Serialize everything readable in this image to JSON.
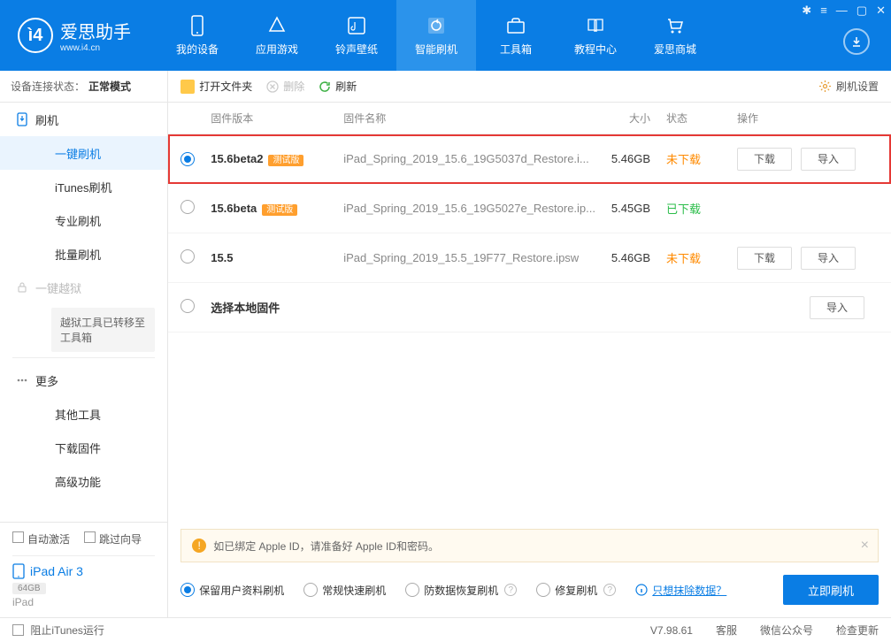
{
  "app": {
    "name": "爱思助手",
    "domain": "www.i4.cn"
  },
  "nav": {
    "items": [
      {
        "label": "我的设备"
      },
      {
        "label": "应用游戏"
      },
      {
        "label": "铃声壁纸"
      },
      {
        "label": "智能刷机"
      },
      {
        "label": "工具箱"
      },
      {
        "label": "教程中心"
      },
      {
        "label": "爱思商城"
      }
    ]
  },
  "status": {
    "prefix": "设备连接状态：",
    "value": "正常模式"
  },
  "sidebar": {
    "flash": "刷机",
    "items": [
      "一键刷机",
      "iTunes刷机",
      "专业刷机",
      "批量刷机"
    ],
    "jailbreak": "一键越狱",
    "jailbreak_note": "越狱工具已转移至工具箱",
    "more": "更多",
    "more_items": [
      "其他工具",
      "下载固件",
      "高级功能"
    ]
  },
  "device_panel": {
    "auto_activate": "自动激活",
    "skip_guide": "跳过向导",
    "name": "iPad Air 3",
    "storage": "64GB",
    "type": "iPad"
  },
  "toolbar": {
    "open": "打开文件夹",
    "delete": "删除",
    "refresh": "刷新",
    "settings": "刷机设置"
  },
  "table": {
    "headers": {
      "version": "固件版本",
      "name": "固件名称",
      "size": "大小",
      "status": "状态",
      "action": "操作"
    },
    "beta_tag": "测试版",
    "download_btn": "下载",
    "import_btn": "导入",
    "rows": [
      {
        "version": "15.6beta2",
        "beta": true,
        "name": "iPad_Spring_2019_15.6_19G5037d_Restore.i...",
        "size": "5.46GB",
        "status": "未下载",
        "status_cls": "no",
        "selected": true,
        "actions": true,
        "highlight": true
      },
      {
        "version": "15.6beta",
        "beta": true,
        "name": "iPad_Spring_2019_15.6_19G5027e_Restore.ip...",
        "size": "5.45GB",
        "status": "已下载",
        "status_cls": "yes",
        "selected": false,
        "actions": false
      },
      {
        "version": "15.5",
        "beta": false,
        "name": "iPad_Spring_2019_15.5_19F77_Restore.ipsw",
        "size": "5.46GB",
        "status": "未下载",
        "status_cls": "no",
        "selected": false,
        "actions": true
      },
      {
        "version": "选择本地固件",
        "beta": false,
        "name": "",
        "size": "",
        "status": "",
        "status_cls": "",
        "selected": false,
        "actions": "import"
      }
    ]
  },
  "warn": "如已绑定 Apple ID，请准备好 Apple ID和密码。",
  "options": {
    "items": [
      "保留用户资料刷机",
      "常规快速刷机",
      "防数据恢复刷机",
      "修复刷机"
    ],
    "erase_link": "只想抹除数据？",
    "flash_now": "立即刷机"
  },
  "footer": {
    "block_itunes": "阻止iTunes运行",
    "version": "V7.98.61",
    "support": "客服",
    "wechat": "微信公众号",
    "update": "检查更新"
  }
}
